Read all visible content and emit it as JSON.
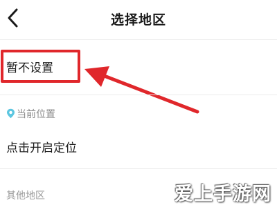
{
  "header": {
    "title": "选择地区",
    "back_icon": "chevron-left-icon"
  },
  "regions": {
    "no_setting_label": "暂不设置",
    "current_location_label": "当前位置",
    "location_icon": "location-pin-icon",
    "enable_location_label": "点击开启定位",
    "other_regions_label": "其他地区"
  },
  "annotation": {
    "highlight_color": "#e0272b"
  },
  "watermark": {
    "text": "爱上手游网"
  }
}
